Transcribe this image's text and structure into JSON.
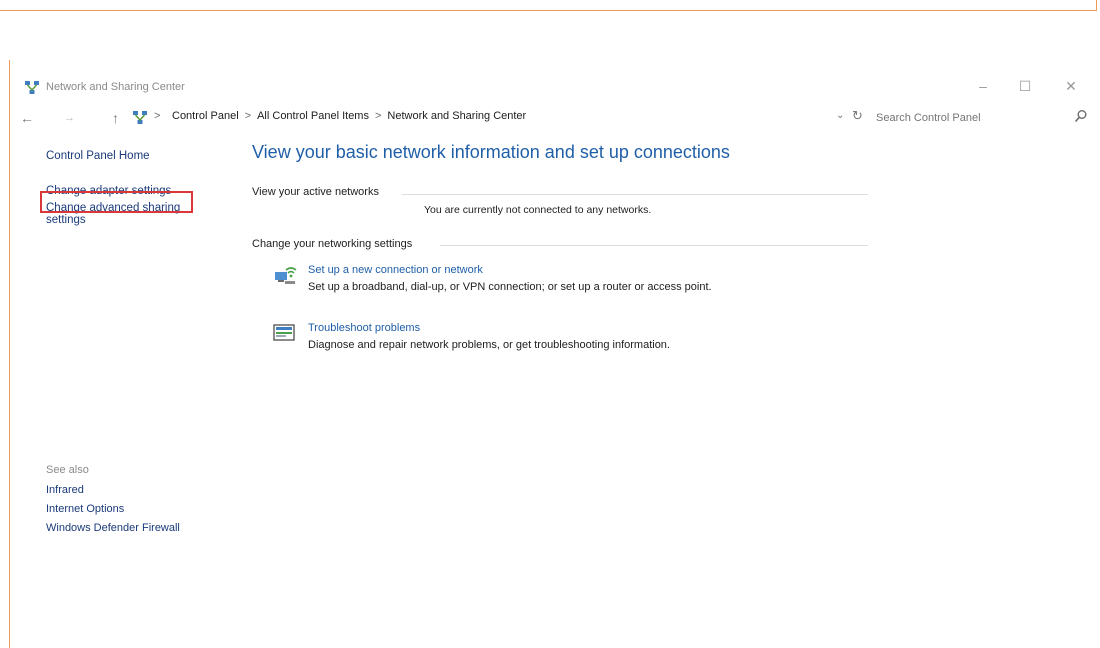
{
  "window": {
    "title": "Network and Sharing Center",
    "minimize_glyph": "–",
    "maximize_glyph": "☐",
    "close_glyph": "✕"
  },
  "address_bar": {
    "back_glyph": "←",
    "forward_glyph": "→",
    "up_glyph": "↑",
    "breadcrumbs": [
      "Control Panel",
      "All Control Panel Items",
      "Network and Sharing Center"
    ],
    "separator": ">",
    "dropdown_glyph": "⌄",
    "refresh_glyph": "↻"
  },
  "search": {
    "placeholder": "Search Control Panel"
  },
  "left_nav": {
    "home": "Control Panel Home",
    "change_adapter": "Change adapter settings",
    "change_advanced_line1": "Change advanced sharing",
    "change_advanced_line2": "settings"
  },
  "main": {
    "title": "View your basic network information and set up connections",
    "active_networks_heading": "View your active networks",
    "not_connected_text": "You are currently not connected to any networks.",
    "change_settings_heading": "Change your networking settings",
    "items": [
      {
        "link": "Set up a new connection or network",
        "description": "Set up a broadband, dial-up, or VPN connection; or set up a router or access point."
      },
      {
        "link": "Troubleshoot problems",
        "description": "Diagnose and repair network problems, or get troubleshooting information."
      }
    ]
  },
  "see_also": {
    "heading": "See also",
    "links": [
      "Infrared",
      "Internet Options",
      "Windows Defender Firewall"
    ]
  },
  "colors": {
    "accent_orange": "#ef9a5b",
    "highlight_red": "#d9373a",
    "title_blue": "#1f5fa8",
    "link_navy": "#1a3a7a"
  }
}
